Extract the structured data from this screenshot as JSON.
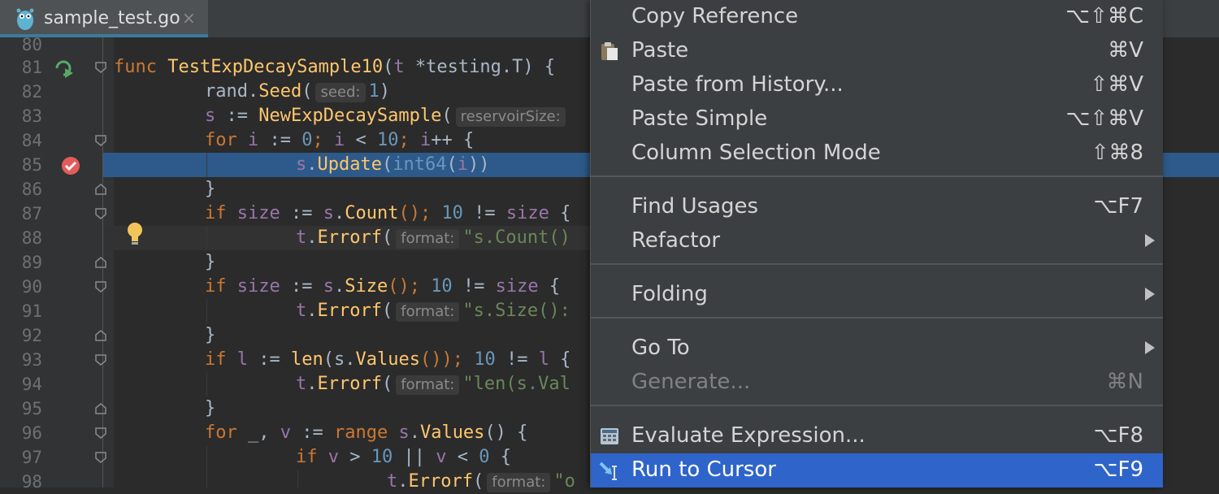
{
  "tab": {
    "filename": "sample_test.go",
    "close": "×"
  },
  "gutter": {
    "line_numbers": [
      "80",
      "81",
      "82",
      "83",
      "84",
      "85",
      "86",
      "87",
      "88",
      "89",
      "90",
      "91",
      "92",
      "93",
      "94",
      "95",
      "96",
      "97",
      "98"
    ]
  },
  "code": {
    "l81": {
      "func": "func ",
      "name": "TestExpDecaySample10",
      "open": "(",
      "t": "t",
      "rest": " *testing.T) {"
    },
    "l82": {
      "pkg": "rand.",
      "fn": "Seed",
      "open": "(",
      "hint": "seed:",
      "num": "1",
      "close": ")"
    },
    "l83": {
      "s": "s",
      "op": " := ",
      "fn": "NewExpDecaySample",
      "open": "(",
      "hint": "reservoirSize:"
    },
    "l84": {
      "kw": "for ",
      "i": "i",
      "op": " := ",
      "n0": "0",
      "semi": "; ",
      "i2": "i",
      "lt": " < ",
      "n10": "10",
      "semi2": "; ",
      "i3": "i",
      "inc": "++ {"
    },
    "l85": {
      "s": "s",
      "dot": ".",
      "fn": "Update",
      "open": "(",
      "cast": "int64",
      "open2": "(",
      "i": "i",
      "close": "))"
    },
    "l86": {
      "text": "}"
    },
    "l87": {
      "kw": "if ",
      "size": "size",
      "op": " := ",
      "s": "s",
      "dot": ".",
      "fn": "Count",
      "call": "(); ",
      "num": "10",
      "ne": " != ",
      "size2": "size",
      "brace": " {"
    },
    "l88": {
      "t": "t",
      "dot": ".",
      "fn": "Errorf",
      "open": "(",
      "hint": "format:",
      "str": "\"s.Count()"
    },
    "l89": {
      "text": "}"
    },
    "l90": {
      "kw": "if ",
      "size": "size",
      "op": " := ",
      "s": "s",
      "dot": ".",
      "fn": "Size",
      "call": "(); ",
      "num": "10",
      "ne": " != ",
      "size2": "size",
      "brace": " {"
    },
    "l91": {
      "t": "t",
      "dot": ".",
      "fn": "Errorf",
      "open": "(",
      "hint": "format:",
      "str": "\"s.Size():"
    },
    "l92": {
      "text": "}"
    },
    "l93": {
      "kw": "if ",
      "l": "l",
      "op": " := ",
      "fn": "len",
      "args": "(s.",
      "fn2": "Values",
      "call": "()); ",
      "num": "10",
      "ne": " != ",
      "l2": "l",
      "brace": " {"
    },
    "l94": {
      "t": "t",
      "dot": ".",
      "fn": "Errorf",
      "open": "(",
      "hint": "format:",
      "str": "\"len(s.Val"
    },
    "l95": {
      "text": "}"
    },
    "l96": {
      "kw": "for ",
      "under": "_, ",
      "v": "v",
      "op": " := ",
      "kw2": "range ",
      "s": "s",
      "dot": ".",
      "fn": "Values",
      "rest": "() {"
    },
    "l97": {
      "kw": "if ",
      "v": "v",
      "gt": " > ",
      "num": "10",
      "or": " || ",
      "v2": "v",
      "lt": " < ",
      "n0": "0",
      "brace": " {"
    },
    "l98": {
      "t": "t",
      "dot": ".",
      "fn": "Errorf",
      "open": "(",
      "hint": "format:",
      "str": "\"o"
    }
  },
  "menu": {
    "items": [
      {
        "label": "Copy Reference",
        "shortcut": "⌥⇧⌘C"
      },
      {
        "label": "Paste",
        "shortcut": "⌘V"
      },
      {
        "label": "Paste from History...",
        "shortcut": "⇧⌘V"
      },
      {
        "label": "Paste Simple",
        "shortcut": "⌥⇧⌘V"
      },
      {
        "label": "Column Selection Mode",
        "shortcut": "⇧⌘8"
      },
      {
        "label": "Find Usages",
        "shortcut": "⌥F7"
      },
      {
        "label": "Refactor",
        "shortcut": ""
      },
      {
        "label": "Folding",
        "shortcut": ""
      },
      {
        "label": "Go To",
        "shortcut": ""
      },
      {
        "label": "Generate...",
        "shortcut": "⌘N"
      },
      {
        "label": "Evaluate Expression...",
        "shortcut": "⌥F8"
      },
      {
        "label": "Run to Cursor",
        "shortcut": "⌥F9"
      }
    ]
  },
  "colors": {
    "accent": "#2f65ca",
    "highlight": "#2d5a8a",
    "keyword": "#cc7832",
    "function": "#ffc66d",
    "number": "#6897bb",
    "string": "#6a8759"
  }
}
